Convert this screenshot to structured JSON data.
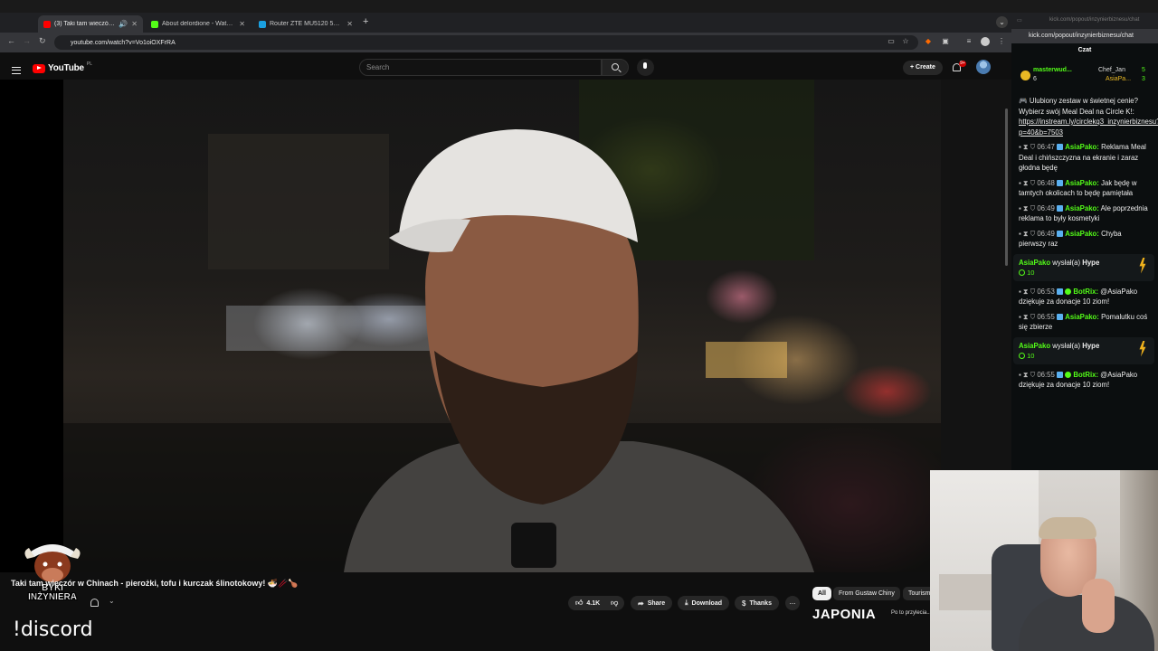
{
  "browser": {
    "tabs": [
      {
        "label": "(3) Taki tam wieczór w Chi..."
      },
      {
        "label": "About delordione - Watch Live"
      },
      {
        "label": "Router ZTE MU5120 5G | zte..."
      }
    ],
    "url": "youtube.com/watch?v=Vo1oiOXFrRA"
  },
  "youtube": {
    "logo_text": "YouTube",
    "region": "PL",
    "search_placeholder": "Search",
    "create_label": "Create",
    "notification_count": "9+",
    "video_title": "Taki tam wieczór w Chinach - pierożki, tofu i kurczak ślinotokowy! 🍜🥢🍗",
    "channel_logo_text": "BYKI INŻYNIERA",
    "actions": {
      "likes": "4.1K",
      "share": "Share",
      "download": "Download",
      "thanks": "Thanks",
      "more": "..."
    },
    "chips": [
      "All",
      "From Gustaw Chiny",
      "Tourism"
    ],
    "recommended_thumb_text": "JAPONIA",
    "recommended_title": "Po to przylecia..."
  },
  "overlay": {
    "command": "!discord"
  },
  "kick_chat": {
    "tab_url": "kick.com/popout/inzynierbiznesu/chat",
    "url": "kick.com/popout/inzynierbiznesu/chat",
    "heading": "Czat",
    "leaders": [
      {
        "name": "masterwud...",
        "count": "6"
      },
      {
        "name": "Chef_Jan",
        "count": "5"
      },
      {
        "name": "AsiaPa...",
        "count": "3"
      }
    ],
    "pinned_text": "Ulubiony zestaw w świetnej cenie? Wybierz swój Meal Deal na Circle K!:",
    "pinned_link": "https://instream.ly/circlekq3_inzynierbiznesu?p=40&b=7503",
    "messages": [
      {
        "time": "06:47",
        "user": "AsiaPako:",
        "text": "Reklama Meal Deal i chińszczyzna na ekranie i zaraz głodna będę"
      },
      {
        "time": "06:48",
        "user": "AsiaPako:",
        "text": "Jak będę w tamtych okolicach to będę pamiętała"
      },
      {
        "time": "06:49",
        "user": "AsiaPako:",
        "text": "Ale poprzednia reklama to były kosmetyki"
      },
      {
        "time": "06:49",
        "user": "AsiaPako:",
        "text": "Chyba pierwszy raz"
      }
    ],
    "hype1": {
      "user": "AsiaPako",
      "verb": "wysłał(a)",
      "item": "Hype",
      "amount": "10"
    },
    "messages2": [
      {
        "time": "06:53",
        "user": "BotRix:",
        "text": "@AsiaPako dziękuje za donacje 10 ziom!"
      },
      {
        "time": "06:55",
        "user": "AsiaPako:",
        "text": "Pomalutku coś się zbierze"
      }
    ],
    "hype2": {
      "user": "AsiaPako",
      "verb": "wysłał(a)",
      "item": "Hype",
      "amount": "10"
    },
    "messages3": [
      {
        "time": "06:55",
        "user": "BotRix:",
        "text": "@AsiaPako dziękuje za donacje 10 ziom!"
      }
    ]
  },
  "colors": {
    "kick_green": "#53fc18",
    "youtube_red": "#ff0000",
    "hype_gold": "#f0b21c"
  }
}
